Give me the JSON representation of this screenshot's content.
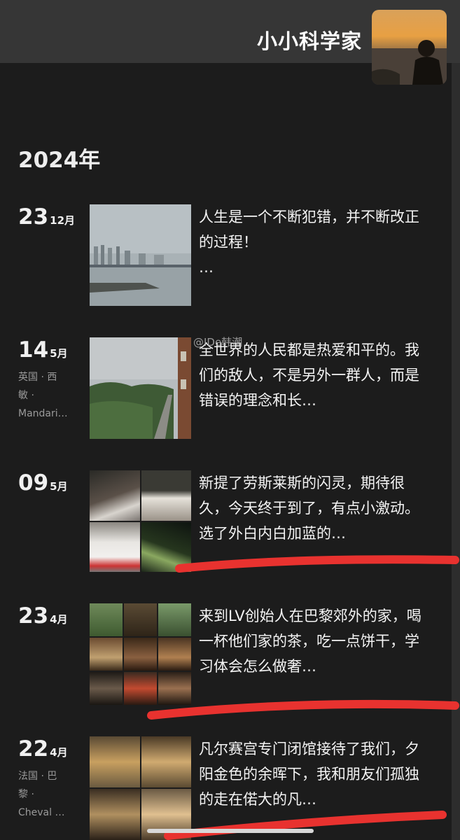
{
  "header": {
    "profile_name": "小小科学家"
  },
  "year_heading": "2024年",
  "watermark": "@IDe韩潮",
  "entries": [
    {
      "day": "23",
      "month": "12月",
      "location": [],
      "text": "人生是一个不断犯错，并不断改正的过程！",
      "ellipsis": "…"
    },
    {
      "day": "14",
      "month": "5月",
      "location": [
        "英国 · 西",
        "敏 ·",
        "Mandari…"
      ],
      "text": "全世界的人民都是热爱和平的。我们的敌人，不是另外一群人，而是错误的理念和长…",
      "ellipsis": ""
    },
    {
      "day": "09",
      "month": "5月",
      "location": [],
      "text": "新提了劳斯莱斯的闪灵，期待很久，今天终于到了，有点小激动。选了外白内白加蓝的…",
      "ellipsis": ""
    },
    {
      "day": "23",
      "month": "4月",
      "location": [],
      "text": "来到LV创始人在巴黎郊外的家，喝一杯他们家的茶，吃一点饼干，学习体会怎么做奢…",
      "ellipsis": ""
    },
    {
      "day": "22",
      "month": "4月",
      "location": [
        "法国 · 巴",
        "黎 ·",
        "Cheval …"
      ],
      "text": "凡尔赛宫专门闭馆接待了我们，夕阳金色的余晖下，我和朋友们孤独的走在偌大的凡…",
      "ellipsis": ""
    }
  ],
  "colors": {
    "background": "#1c1c1c",
    "header_bar": "#363636",
    "annotation_red": "#e8322f"
  }
}
